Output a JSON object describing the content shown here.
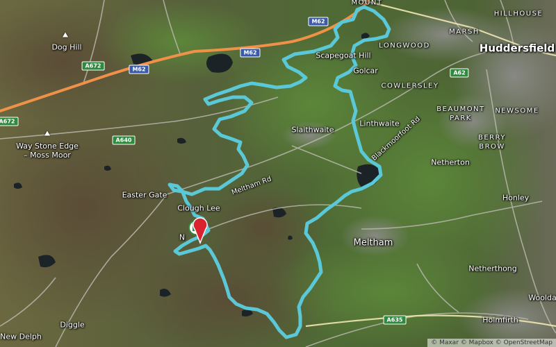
{
  "map": {
    "places": [
      {
        "id": "dog-hill",
        "text": "Dog Hill"
      },
      {
        "id": "way-stone-edge",
        "text": "Way Stone Edge\n– Moss Moor"
      },
      {
        "id": "easter-gate",
        "text": "Easter Gate"
      },
      {
        "id": "clough-lee",
        "text": "Clough Lee"
      },
      {
        "id": "new-delph",
        "text": "New Delph"
      },
      {
        "id": "diggle",
        "text": "Diggle"
      },
      {
        "id": "huddersfield",
        "text": "Huddersfield"
      },
      {
        "id": "hillhouse",
        "text": "HILLHOUSE"
      },
      {
        "id": "marsh",
        "text": "MARSH"
      },
      {
        "id": "longwood",
        "text": "LONGWOOD"
      },
      {
        "id": "golcar",
        "text": "Golcar"
      },
      {
        "id": "scapegoat-hill",
        "text": "Scapegoat Hill"
      },
      {
        "id": "cowlersley",
        "text": "COWLERSLEY"
      },
      {
        "id": "beaumont-park",
        "text": "BEAUMONT\nPARK"
      },
      {
        "id": "newsome",
        "text": "NEWSOME"
      },
      {
        "id": "berry-brow",
        "text": "BERRY\nBROW"
      },
      {
        "id": "slaithwaite",
        "text": "Slaithwaite"
      },
      {
        "id": "linthwaite",
        "text": "Linthwaite"
      },
      {
        "id": "netherton",
        "text": "Netherton"
      },
      {
        "id": "honley",
        "text": "Honley"
      },
      {
        "id": "meltham",
        "text": "Meltham"
      },
      {
        "id": "netherthong",
        "text": "Netherthong"
      },
      {
        "id": "holmfirth",
        "text": "Holmfirth"
      },
      {
        "id": "wooldale",
        "text": "Wooldal"
      },
      {
        "id": "mount",
        "text": "MOUNT"
      },
      {
        "id": "marsden",
        "text": "N"
      },
      {
        "id": "meltham-rd",
        "text": "Meltham Rd"
      },
      {
        "id": "blackmoorfoot-rd",
        "text": "Blackmoorfoot Rd"
      }
    ],
    "road_shields": [
      {
        "id": "m62-a",
        "text": "M62",
        "color": "blue"
      },
      {
        "id": "m62-b",
        "text": "M62",
        "color": "blue"
      },
      {
        "id": "m62-c",
        "text": "M62",
        "color": "blue"
      },
      {
        "id": "a672-a",
        "text": "A672",
        "color": "green"
      },
      {
        "id": "a672-b",
        "text": "A672",
        "color": "green"
      },
      {
        "id": "a640",
        "text": "A640",
        "color": "green"
      },
      {
        "id": "a62",
        "text": "A62",
        "color": "green"
      },
      {
        "id": "a635",
        "text": "A635",
        "color": "green"
      }
    ],
    "route_color": "#5bc8d8",
    "motorway_color": "#f0914a",
    "attribution": "© Maxar © Mapbox © OpenStreetMap"
  }
}
